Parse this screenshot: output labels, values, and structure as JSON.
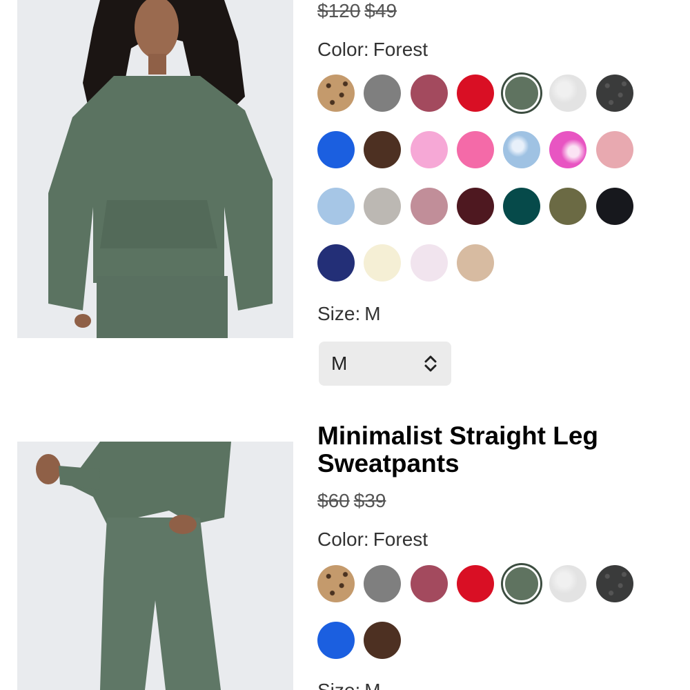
{
  "products": [
    {
      "title": "",
      "original_price": "$120",
      "sale_price": "$49",
      "color_label": "Color:",
      "color_value": "Forest",
      "size_label": "Size:",
      "size_value": "M",
      "size_select_value": "M",
      "image_icon": "hoodie-photo",
      "swatches": [
        {
          "name": "leopard",
          "color": "#c49a6c"
        },
        {
          "name": "grey",
          "color": "#7f7f7f"
        },
        {
          "name": "berry",
          "color": "#a34a5e"
        },
        {
          "name": "red",
          "color": "#d90f24"
        },
        {
          "name": "forest",
          "color": "#5f7360",
          "selected": true
        },
        {
          "name": "light-grey",
          "color": "#e3e3e3"
        },
        {
          "name": "black-leopard",
          "color": "#3a3b3b"
        },
        {
          "name": "blue",
          "color": "#1b5fe0"
        },
        {
          "name": "brown",
          "color": "#4d3022"
        },
        {
          "name": "pink",
          "color": "#f6a8d6"
        },
        {
          "name": "hot-pink",
          "color": "#f46aa8"
        },
        {
          "name": "tie-dye-blue",
          "color": "#9fc2e3"
        },
        {
          "name": "tie-dye-pink",
          "color": "#e855c2"
        },
        {
          "name": "blush",
          "color": "#e8a9b0"
        },
        {
          "name": "sky-blue",
          "color": "#a6c6e6"
        },
        {
          "name": "stone",
          "color": "#bcb8b3"
        },
        {
          "name": "mauve",
          "color": "#c18e99"
        },
        {
          "name": "maroon",
          "color": "#4e1820"
        },
        {
          "name": "teal",
          "color": "#064a4a"
        },
        {
          "name": "olive",
          "color": "#6b6a44"
        },
        {
          "name": "black",
          "color": "#17181d"
        },
        {
          "name": "navy",
          "color": "#232f77"
        },
        {
          "name": "cream",
          "color": "#f5efd5"
        },
        {
          "name": "lavender-white",
          "color": "#f1e4ee"
        },
        {
          "name": "sand",
          "color": "#d7bba1"
        }
      ]
    },
    {
      "title": "Minimalist Straight Leg Sweatpants",
      "original_price": "$60",
      "sale_price": "$39",
      "color_label": "Color:",
      "color_value": "Forest",
      "size_label": "Size:",
      "size_value": "M",
      "image_icon": "sweatpants-photo",
      "swatches": [
        {
          "name": "leopard",
          "color": "#c49a6c"
        },
        {
          "name": "grey",
          "color": "#7f7f7f"
        },
        {
          "name": "berry",
          "color": "#a34a5e"
        },
        {
          "name": "red",
          "color": "#d90f24"
        },
        {
          "name": "forest",
          "color": "#5f7360",
          "selected": true
        },
        {
          "name": "light-grey",
          "color": "#e3e3e3"
        },
        {
          "name": "black-leopard",
          "color": "#3a3b3b"
        },
        {
          "name": "blue",
          "color": "#1b5fe0"
        },
        {
          "name": "brown",
          "color": "#4d3022"
        }
      ]
    }
  ]
}
